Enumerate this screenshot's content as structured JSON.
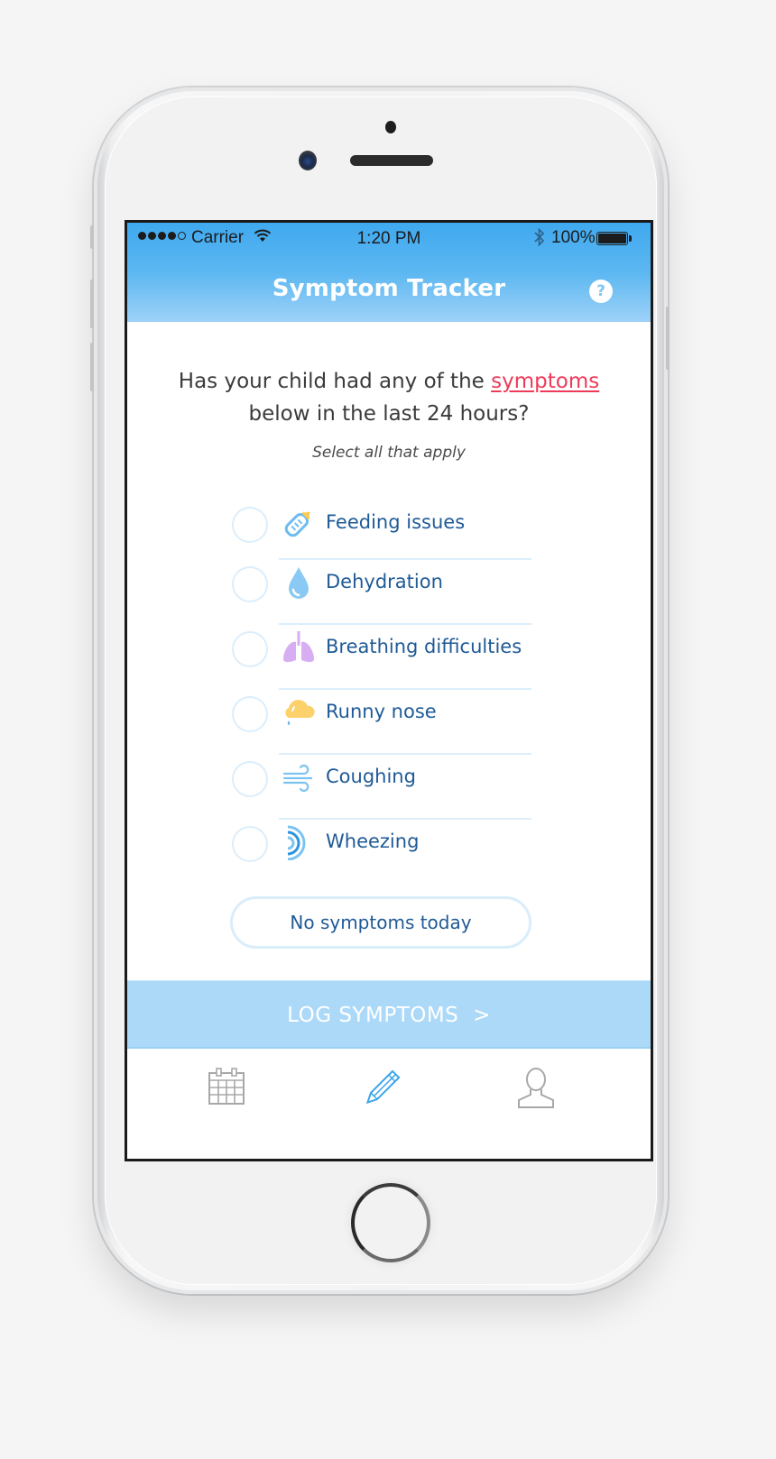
{
  "status_bar": {
    "signal_dots_filled": 4,
    "signal_dots_total": 5,
    "carrier": "Carrier",
    "time": "1:20 PM",
    "battery_percent": "100%",
    "icons": [
      "wifi-icon",
      "bluetooth-icon",
      "battery-icon"
    ]
  },
  "header": {
    "title": "Symptom Tracker",
    "help_label": "?",
    "help_icon": "help-icon"
  },
  "question": {
    "prefix": "Has your child had any of the ",
    "link": "symptoms",
    "suffix": "below in the last 24 hours?",
    "hint": "Select all that apply"
  },
  "symptoms": [
    {
      "label": "Feeding issues",
      "icon": "baby-bottle-icon",
      "checked": false
    },
    {
      "label": "Dehydration",
      "icon": "water-drop-icon",
      "checked": false
    },
    {
      "label": "Breathing difficulties",
      "icon": "lungs-icon",
      "checked": false
    },
    {
      "label": "Runny nose",
      "icon": "cloud-drip-icon",
      "checked": false
    },
    {
      "label": "Coughing",
      "icon": "wind-icon",
      "checked": false
    },
    {
      "label": "Wheezing",
      "icon": "sound-waves-icon",
      "checked": false
    }
  ],
  "no_symptoms_label": "No symptoms today",
  "log_button": {
    "label": "LOG SYMPTOMS",
    "chevron": ">"
  },
  "tabs": [
    {
      "name": "calendar",
      "icon": "calendar-icon",
      "active": false
    },
    {
      "name": "log",
      "icon": "pencil-icon",
      "active": true
    },
    {
      "name": "profile",
      "icon": "user-icon",
      "active": false
    }
  ],
  "colors": {
    "header_top": "#3fa9ef",
    "header_bottom": "#9ed2f8",
    "link": "#ee3a58",
    "label": "#1f5a96",
    "log_button": "#acd9f8",
    "tab_active": "#3aa5ec",
    "tab_inactive": "#a8a8a8"
  }
}
